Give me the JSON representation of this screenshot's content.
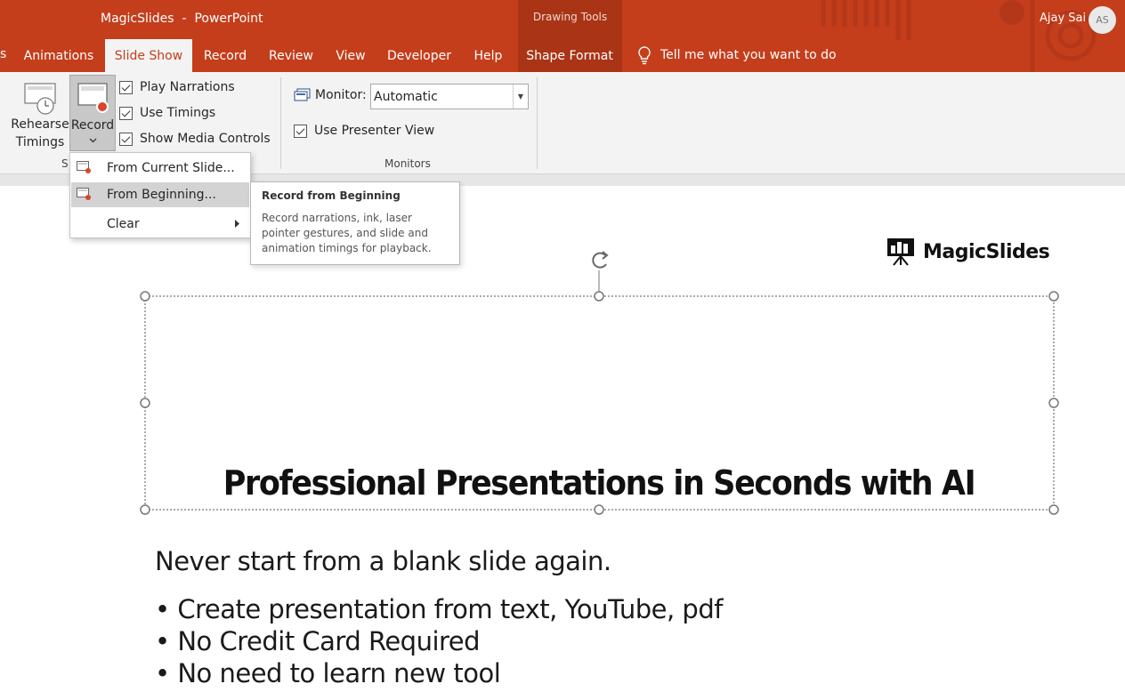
{
  "window": {
    "title": "MagicSlides  -  PowerPoint",
    "context_group": "Drawing Tools",
    "user_name": "Ajay Sai",
    "user_initials": "AS"
  },
  "tabs": [
    {
      "label": "s",
      "active": false
    },
    {
      "label": "Animations",
      "active": false
    },
    {
      "label": "Slide Show",
      "active": true
    },
    {
      "label": "Record",
      "active": false
    },
    {
      "label": "Review",
      "active": false
    },
    {
      "label": "View",
      "active": false
    },
    {
      "label": "Developer",
      "active": false
    },
    {
      "label": "Help",
      "active": false
    },
    {
      "label": "Shape Format",
      "active": false
    }
  ],
  "tell_me": "Tell me what you want to do",
  "ribbon": {
    "rehearse_label_1": "Rehearse",
    "rehearse_label_2": "Timings",
    "record_label": "Record",
    "setup_group_partial": "S",
    "checkboxes": [
      {
        "label": "Play Narrations",
        "checked": true
      },
      {
        "label": "Use Timings",
        "checked": true
      },
      {
        "label": "Show Media Controls",
        "checked": true
      }
    ],
    "monitor_label": "Monitor:",
    "monitor_value": "Automatic",
    "presenter_view": {
      "label": "Use Presenter View",
      "checked": true
    },
    "monitors_group": "Monitors"
  },
  "record_menu": {
    "items": [
      {
        "label": "From Current Slide...",
        "icon": "record-slide-icon"
      },
      {
        "label": "From Beginning...",
        "icon": "record-slide-icon",
        "highlighted": true
      },
      {
        "label": "Clear",
        "has_submenu": true
      }
    ]
  },
  "tooltip": {
    "title": "Record from Beginning",
    "body": "Record narrations, ink, laser pointer gestures, and slide and animation timings for playback."
  },
  "slide": {
    "logo_text": "MagicSlides",
    "title": "Professional Presentations in Seconds with AI",
    "intro": "Never start from a blank slide again.",
    "bullets": [
      "• Create presentation from text, YouTube, pdf",
      "• No Credit Card Required",
      "• No need to learn new tool"
    ]
  },
  "colors": {
    "accent": "#c43e1c",
    "ribbon_bg": "#f3f3f3"
  }
}
